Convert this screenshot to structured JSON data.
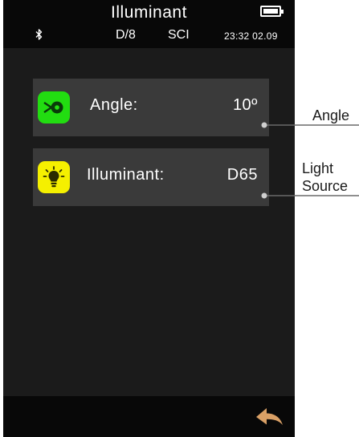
{
  "status_bar": {
    "title": "Illuminant",
    "geometry": "D/8",
    "mode": "SCI",
    "clock": "23:32 02.09",
    "icons": [
      "bluetooth-icon",
      "battery-icon"
    ]
  },
  "settings": {
    "angle": {
      "label": "Angle:",
      "value": "10º",
      "icon": "observer-angle-icon",
      "icon_color": "#22dd11"
    },
    "illuminant": {
      "label": "Illuminant:",
      "value": "D65",
      "icon": "lightbulb-icon",
      "icon_color": "#f5f000"
    }
  },
  "bottom_bar": {
    "back_icon": "back-arrow-icon",
    "back_color": "#d9a066"
  },
  "callouts": {
    "angle": "Angle",
    "light_source_line1": "Light",
    "light_source_line2": "Source"
  }
}
